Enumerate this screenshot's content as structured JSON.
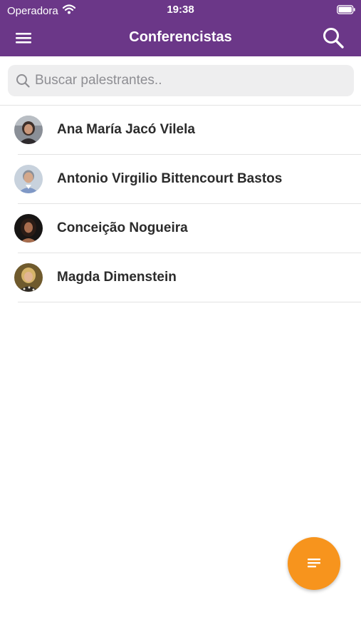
{
  "status_bar": {
    "carrier": "Operadora",
    "time": "19:38",
    "icons": [
      "wifi-icon",
      "battery-icon"
    ]
  },
  "header": {
    "title": "Conferencistas",
    "left_icon": "menu-icon",
    "right_icon": "search-icon",
    "background_color": "#6b3788"
  },
  "search": {
    "placeholder": "Buscar palestrantes..",
    "value": ""
  },
  "speakers": [
    {
      "name": "Ana María Jacó Vilela"
    },
    {
      "name": "Antonio Virgilio Bittencourt Bastos"
    },
    {
      "name": "Conceição Nogueira"
    },
    {
      "name": "Magda Dimenstein"
    }
  ],
  "fab": {
    "icon": "sort-icon",
    "color": "#f7941d"
  }
}
